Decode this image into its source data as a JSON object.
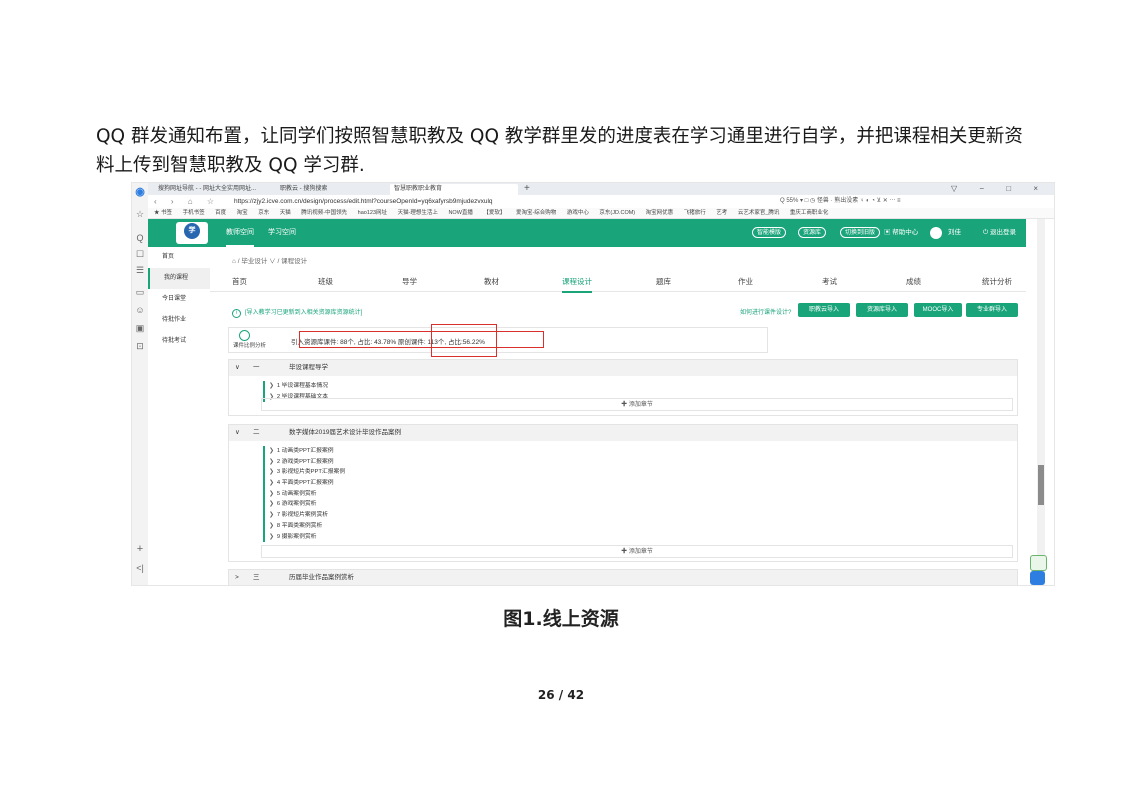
{
  "paragraph": "QQ 群发通知布置，让同学们按照智慧职教及 QQ 教学群里发的进度表在学习通里进行自学，并把课程相关更新资料上传到智慧职教及 QQ 学习群.",
  "caption": "图1.线上资源",
  "page_number": "26 / 42",
  "screenshot": {
    "browser_sidebar_icons": [
      "☆",
      "Q",
      "☐",
      "☰",
      "▭",
      "☺",
      "▣",
      "⊡"
    ],
    "tabs": [
      {
        "label": "搜狗网址导航 - - 网址大全实用网址..."
      },
      {
        "label": "职教云 - 搜狗搜索"
      },
      {
        "label": "智慧职教职业教育"
      }
    ],
    "window_controls": "▽ − □ ×",
    "url": "https://zjy2.icve.com.cn/design/process/edit.html?courseOpenId=yq6xafyrsb9mjudezvxulq",
    "address_right": "Q 55% ▾ □ ◷ 怪兽 · 熊出没素     ♀ ◐ ◔ ⊻ ✕ ⋯ ≡",
    "bookmarks": [
      "★ 书签",
      "手机书签",
      "百度",
      "淘宝",
      "京东",
      "天猫",
      "腾讯视频-中国领先",
      "hao123网址",
      "天猫-理想生活上",
      "NOW直播",
      "【爱软】",
      "爱淘宝-综合购物",
      "游戏中心",
      "京东(JD.COM)",
      "淘宝网优惠",
      "飞猪旅行",
      "艺考",
      "云艺术家官_腾讯",
      "重庆工商职业化"
    ],
    "header": {
      "logo_text": "学",
      "nav": [
        "教师空间",
        "学习空间"
      ],
      "pills": [
        "智能模版",
        "资源库",
        "切换到旧版"
      ],
      "help": "▣ 帮助中心",
      "user": "刘佳",
      "logout": "⏻ 退出登录"
    },
    "sidebar": [
      "首页",
      "我的课程",
      "今日课堂",
      "待批作业",
      "待批考试"
    ],
    "sidebar_bottom": [
      "+",
      "<|"
    ],
    "breadcrumb": "⌂ / 毕业设计 ∨ / 课程设计",
    "course_tabs": [
      "首页",
      "班级",
      "导学",
      "教材",
      "课程设计",
      "题库",
      "作业",
      "考试",
      "成绩",
      "统计分析"
    ],
    "active_tab": "课程设计",
    "tip_icon": "i",
    "tip": "[导入教学习已更新到入相关资源库资源统计]",
    "howto": "如何进行课件设计?",
    "import_buttons": [
      "职教云导入",
      "资源库导入",
      "MOOC导入",
      "专业群导入"
    ],
    "stats_label": "课件比例分析",
    "stats_text": "引入资源库课件: 88个, 占比: 43.78%  原创课件: 113个, 占比:56.22%",
    "sections": [
      {
        "toggle": "∨",
        "index": "一",
        "title": "毕设课程导学",
        "items": [
          "1  毕设课程基本情况",
          "2  毕设课程基础文本"
        ],
        "add_label": "✚ 添加章节"
      },
      {
        "toggle": "∨",
        "index": "二",
        "title": "数字媒体2019届艺术设计毕设作品案例",
        "items": [
          "1  动画类PPT汇报案例",
          "2  游戏类PPT汇报案例",
          "3  影视短片类PPT汇报案例",
          "4  平面类PPT汇报案例",
          "5  动画案例赏析",
          "6  游戏案例赏析",
          "7  影视短片案例赏析",
          "8  平面类案例赏析",
          "9  摄影案例赏析"
        ],
        "add_label": "✚ 添加章节"
      },
      {
        "toggle": ">",
        "index": "三",
        "title": "历届毕业作品案例赏析"
      }
    ]
  }
}
